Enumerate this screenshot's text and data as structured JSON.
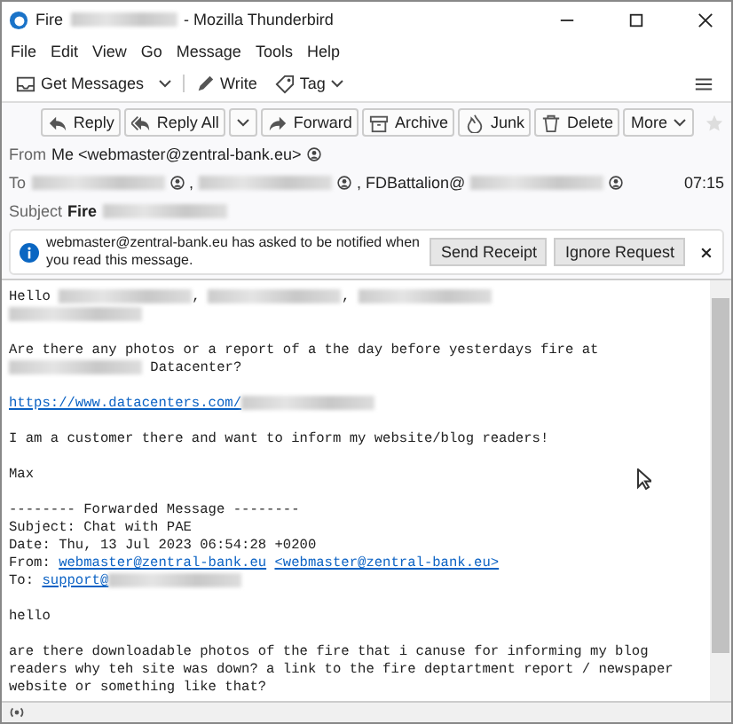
{
  "window": {
    "title": [
      {
        "kind": "text",
        "text": "Fire"
      },
      {
        "kind": "redacted"
      },
      {
        "kind": "text",
        "text": "- Mozilla Thunderbird"
      }
    ]
  },
  "menu": [
    "File",
    "Edit",
    "View",
    "Go",
    "Message",
    "Tools",
    "Help"
  ],
  "toolbar": [
    {
      "kind": "button",
      "label": "Get Messages"
    },
    {
      "kind": "dropdown"
    },
    {
      "kind": "button",
      "label": "Write"
    },
    {
      "kind": "menu",
      "label": "Tag"
    }
  ],
  "message_actions": [
    {
      "kind": "button",
      "label": "Reply"
    },
    {
      "kind": "split",
      "label": "Reply All"
    },
    {
      "kind": "button",
      "label": "Forward"
    },
    {
      "kind": "button",
      "label": "Archive"
    },
    {
      "kind": "button",
      "label": "Junk"
    },
    {
      "kind": "button",
      "label": "Delete"
    },
    {
      "kind": "menu",
      "label": "More"
    }
  ],
  "headers": {
    "from_label": "From",
    "from": "Me <webmaster@zentral-bank.eu>",
    "to_label": "To",
    "to": [
      {
        "kind": "redacted"
      },
      {
        "kind": "contact"
      },
      {
        "kind": "text",
        "text": ","
      },
      {
        "kind": "redacted"
      },
      {
        "kind": "contact"
      },
      {
        "kind": "text",
        "text": ", FDBattalion@"
      },
      {
        "kind": "redacted"
      },
      {
        "kind": "contact"
      }
    ],
    "time": "07:15",
    "subject_label": "Subject",
    "subject": "Fire"
  },
  "notification": {
    "text": "webmaster@zentral-bank.eu has asked to be notified when you read this message.",
    "buttons": [
      "Send Receipt",
      "Ignore Request"
    ]
  },
  "body": [
    [
      [
        {
          "kind": "text",
          "text": "Hello "
        },
        {
          "kind": "redacted"
        },
        {
          "kind": "text",
          "text": ", "
        },
        {
          "kind": "redacted"
        },
        {
          "kind": "text",
          "text": ", "
        },
        {
          "kind": "redacted"
        }
      ],
      [
        {
          "kind": "redacted"
        }
      ]
    ],
    [
      [
        {
          "kind": "text",
          "text": "Are there any photos or a report of a the day before yesterdays fire at"
        }
      ],
      [
        {
          "kind": "redacted"
        },
        {
          "kind": "text",
          "text": " Datacenter?"
        }
      ]
    ],
    [
      [
        {
          "kind": "link",
          "text": "https://www.datacenters.com/"
        },
        {
          "kind": "redacted"
        }
      ]
    ],
    [
      [
        {
          "kind": "text",
          "text": "I am a customer there and want to inform my website/blog readers!"
        }
      ]
    ],
    [
      [
        {
          "kind": "text",
          "text": "Max"
        }
      ]
    ],
    [
      [
        {
          "kind": "text",
          "text": "-------- Forwarded Message --------"
        }
      ],
      [
        {
          "kind": "text",
          "text": "Subject: Chat with PAE"
        }
      ],
      [
        {
          "kind": "text",
          "text": "Date: Thu, 13 Jul 2023 06:54:28 +0200"
        }
      ],
      [
        {
          "kind": "text",
          "text": "From: "
        },
        {
          "kind": "link",
          "text": "webmaster@zentral-bank.eu"
        },
        {
          "kind": "link",
          "text": "<webmaster@zentral-bank.eu>"
        }
      ],
      [
        {
          "kind": "text",
          "text": "To: "
        },
        {
          "kind": "link",
          "text": "support@"
        },
        {
          "kind": "redacted"
        }
      ]
    ],
    [
      [
        {
          "kind": "text",
          "text": "hello"
        }
      ]
    ],
    [
      [
        {
          "kind": "text",
          "text": "are there downloadable photos of the fire that i canuse for informing my blog"
        }
      ],
      [
        {
          "kind": "text",
          "text": "readers why teh site was down? a link to the fire deptartment report / newspaper"
        }
      ],
      [
        {
          "kind": "text",
          "text": "website or something like that?"
        }
      ]
    ]
  ]
}
